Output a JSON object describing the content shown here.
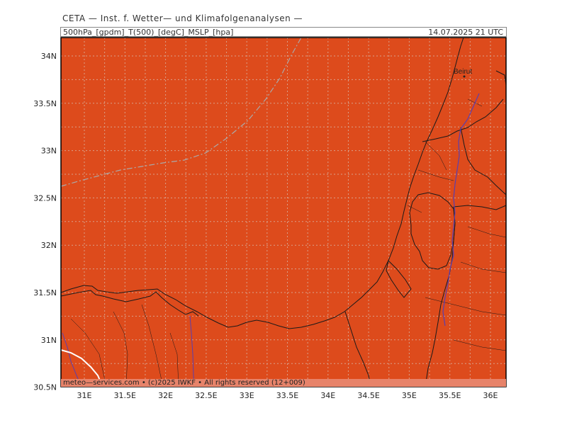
{
  "header": {
    "model_line": "CETA — Inst. f. Wetter— und Klimafolgenanalysen —",
    "params": "500hPa_[gpdm]_T(500)_[degC]_MSLP_[hpa]",
    "valid_time": "14.07.2025 21 UTC"
  },
  "map": {
    "fill_color": "#dd4b1c",
    "grid_color": "#d9a08a",
    "border_color": "#1a1a1a",
    "river_color": "#5a3fb0",
    "contour_color": "#aaaaaa",
    "isotherm_color": "#ffffff",
    "lat_labels": [
      "34N",
      "33.5N",
      "33N",
      "32.5N",
      "32N",
      "31.5N",
      "31N",
      "30.5N"
    ],
    "lon_labels": [
      "31E",
      "31.5E",
      "32E",
      "32.5E",
      "33E",
      "33.5E",
      "34E",
      "34.5E",
      "35E",
      "35.5E",
      "36E"
    ],
    "city_labels": [
      "Beirut"
    ]
  },
  "footer": {
    "credit": "meteo—services.com • (c)2025 IWKF • All rights reserved (12+009)"
  }
}
